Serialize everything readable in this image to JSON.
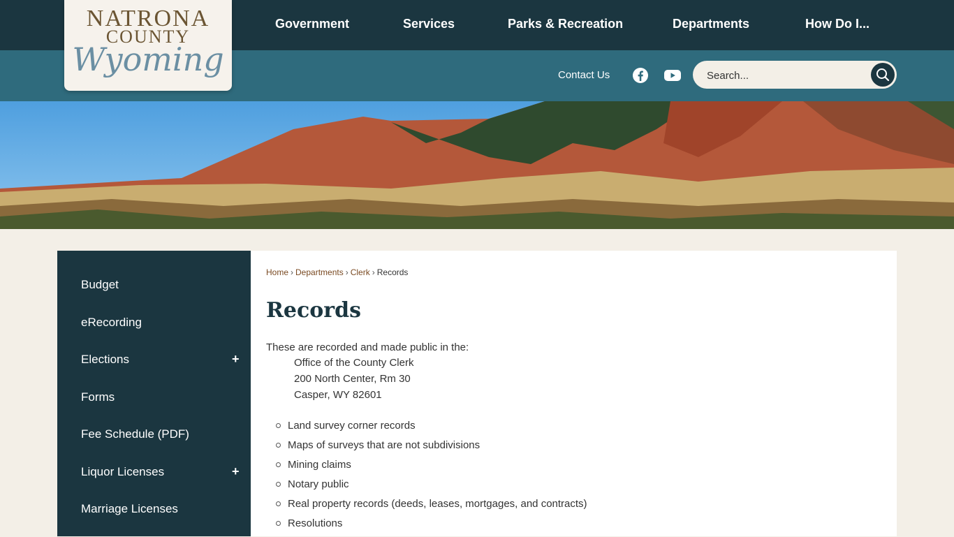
{
  "logo": {
    "line1": "NATRONA",
    "line2": "COUNTY",
    "line3": "Wyoming"
  },
  "topnav": [
    "Government",
    "Services",
    "Parks & Recreation",
    "Departments",
    "How Do I..."
  ],
  "utility": {
    "contact": "Contact Us",
    "search_placeholder": "Search..."
  },
  "icons": {
    "facebook": "facebook-icon",
    "youtube": "youtube-icon",
    "search": "search-icon",
    "expand": "plus-icon"
  },
  "sidebar": {
    "items": [
      {
        "label": "Budget",
        "expandable": false
      },
      {
        "label": "eRecording",
        "expandable": false
      },
      {
        "label": "Elections",
        "expandable": true
      },
      {
        "label": "Forms",
        "expandable": false
      },
      {
        "label": "Fee Schedule (PDF)",
        "expandable": false
      },
      {
        "label": "Liquor Licenses",
        "expandable": true
      },
      {
        "label": "Marriage Licenses",
        "expandable": false
      }
    ],
    "expand_symbol": "+"
  },
  "breadcrumb": {
    "home": "Home",
    "departments": "Departments",
    "clerk": "Clerk",
    "current": "Records",
    "sep": "›"
  },
  "main": {
    "title": "Records",
    "intro": "These are recorded and made public in the:",
    "address": [
      "Office of the County Clerk",
      "200 North Center, Rm 30",
      "Casper, WY 82601"
    ],
    "records": [
      "Land survey corner records",
      "Maps of surveys that are not subdivisions",
      "Mining claims",
      "Notary public",
      "Real property records (deeds, leases, mortgages, and contracts)",
      "Resolutions"
    ]
  },
  "colors": {
    "nav": "#1b3640",
    "subnav": "#2f6b7d",
    "page_bg": "#f3efe7",
    "link": "#7a4a22"
  }
}
